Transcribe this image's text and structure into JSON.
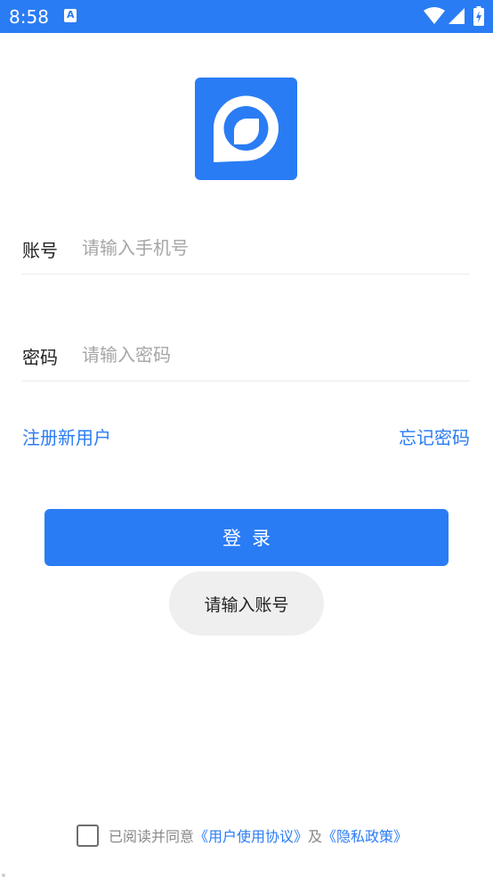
{
  "status_bar": {
    "time": "8:58",
    "notification_glyph": "A",
    "bg_color": "#2a7cf4"
  },
  "logo": {
    "icon": "app-logo-icon",
    "color": "#2a7cf4"
  },
  "form": {
    "account_label": "账号",
    "account_placeholder": "请输入手机号",
    "account_value": "",
    "password_label": "密码",
    "password_placeholder": "请输入密码",
    "password_value": ""
  },
  "links": {
    "register": "注册新用户",
    "forgot_password": "忘记密码"
  },
  "login_button": {
    "label": "登录"
  },
  "toast": {
    "message": "请输入账号"
  },
  "agreement": {
    "checked": false,
    "prefix": "已阅读并同意",
    "user_agreement": "《用户使用协议》",
    "conjunction": "及",
    "privacy_policy": "《隐私政策》"
  },
  "colors": {
    "accent": "#2a7cf4",
    "placeholder": "#a6a6a6",
    "toast_bg": "#efefef"
  }
}
